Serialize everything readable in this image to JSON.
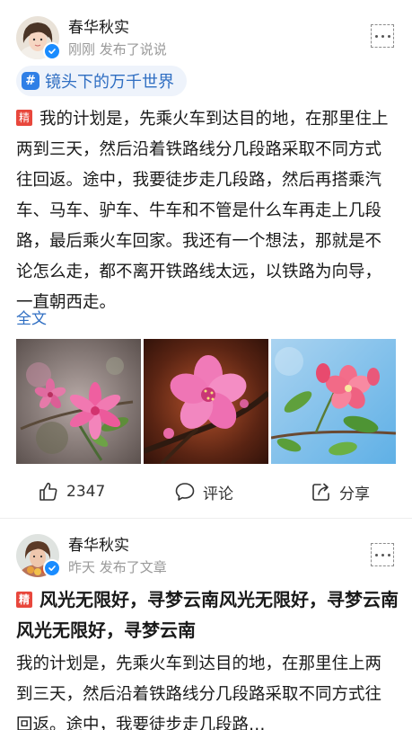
{
  "post1": {
    "author": "春华秋实",
    "meta": "刚刚 发布了说说",
    "topic": "镜头下的万千世界",
    "badge": "精",
    "body": "我的计划是，先乘火车到达目的地，在那里住上两到三天，然后沿着铁路线分几段路采取不同方式往回返。途中，我要徒步走几段路，然后再搭乘汽车、马车、驴车、牛车和不管是什么车再走上几段路，最后乘火车回家。我还有一个想法，那就是不论怎么走，都不离开铁路线太远，以铁路为向导，一直朝西走。",
    "full_text_link": "全文",
    "photos": [
      "pink-blossom-photo",
      "peach-blossom-photo",
      "crabapple-blossom-photo"
    ],
    "actions": {
      "like_count": "2347",
      "comment_label": "评论",
      "share_label": "分享"
    }
  },
  "post2": {
    "author": "春华秋实",
    "meta": "昨天 发布了文章",
    "badge": "精",
    "title": "风光无限好，寻梦云南风光无限好，寻梦云南风光无限好，寻梦云南",
    "body": "我的计划是，先乘火车到达目的地，在那里住上两到三天，然后沿着铁路线分几段路采取不同方式往回返。途中，我要徒步走几段路…"
  },
  "colors": {
    "link": "#2f6ec2",
    "topic_bg": "#eef3fb",
    "topic_icon": "#2f7fe6",
    "badge": "#e8473c",
    "verified": "#1a8cff",
    "meta_text": "#9a9a9a"
  },
  "icons": {
    "like": "thumbs-up-icon",
    "comment": "comment-bubble-icon",
    "share": "share-icon",
    "more": "more-dots-icon",
    "topic": "hashtag-icon",
    "verified": "verified-badge-icon"
  }
}
